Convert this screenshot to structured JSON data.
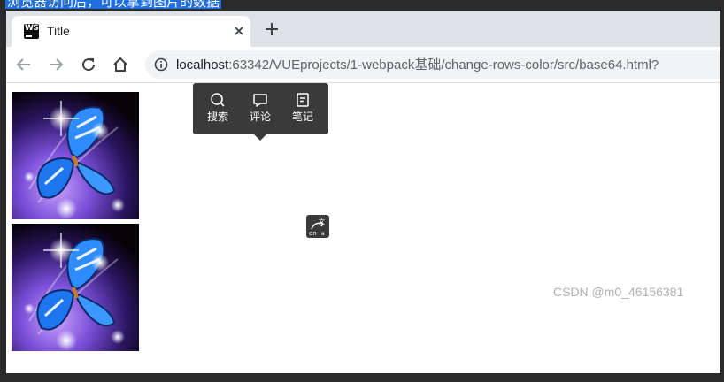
{
  "selected_text": "浏览器访问后，可以拿到图片的数据",
  "tab": {
    "favicon": "webstorm-icon",
    "favicon_text": "WS",
    "title": "Title",
    "close_icon": "close-icon"
  },
  "new_tab_icon": "plus-icon",
  "toolbar": {
    "back_icon": "back-arrow-icon",
    "forward_icon": "forward-arrow-icon",
    "reload_icon": "reload-icon",
    "home_icon": "home-icon"
  },
  "address_bar": {
    "info_icon": "info-icon",
    "host": "localhost",
    "path": ":63342/VUEprojects/1-webpack基础/change-rows-color/src/base64.html?"
  },
  "page": {
    "images": [
      {
        "name": "butterfly-image-1",
        "alt": "butterfly"
      },
      {
        "name": "butterfly-image-2",
        "alt": "butterfly"
      }
    ]
  },
  "context_popup": {
    "items": [
      {
        "label": "搜索",
        "icon": "search-icon"
      },
      {
        "label": "评论",
        "icon": "comment-icon"
      },
      {
        "label": "笔记",
        "icon": "note-icon"
      }
    ]
  },
  "translate_icon": "translate-icon",
  "watermark": "CSDN @m0_46156381",
  "colors": {
    "selection": "#1f6fe0",
    "tabbar": "#dee1e6",
    "omnibox": "#f1f3f4",
    "popup": "#3a3a3a"
  }
}
